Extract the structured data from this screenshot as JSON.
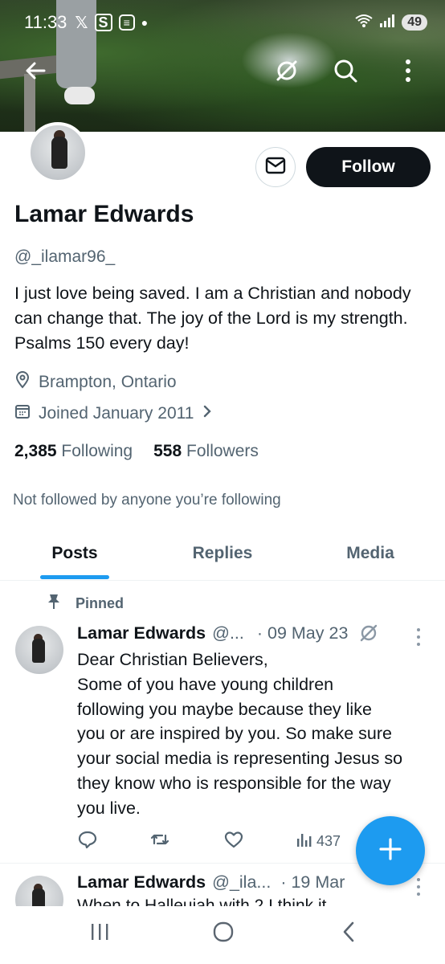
{
  "status_bar": {
    "time": "11:33",
    "icons": [
      "x-icon",
      "s-icon",
      "news-icon",
      "dot-icon"
    ],
    "battery": "49"
  },
  "header": {
    "back_icon": "arrow-left-icon",
    "grok_icon": "grok-icon",
    "search_icon": "search-icon",
    "more_icon": "more-vertical-icon"
  },
  "profile": {
    "name": "Lamar Edwards",
    "handle": "@_ilamar96_",
    "bio": "I just love being saved. I am a Christian and nobody can change that. The joy of the Lord is my strength. Psalms 150 every day!",
    "location": "Brampton, Ontario",
    "joined": "Joined January 2011",
    "following_count": "2,385",
    "following_label": "Following",
    "followers_count": "558",
    "followers_label": "Followers",
    "not_followed": "Not followed by anyone you’re following",
    "follow_label": "Follow"
  },
  "tabs": [
    {
      "label": "Posts",
      "active": true
    },
    {
      "label": "Replies",
      "active": false
    },
    {
      "label": "Media",
      "active": false
    }
  ],
  "posts": [
    {
      "pinned_label": "Pinned",
      "name": "Lamar Edwards",
      "handle": "@...",
      "date": "· 09 May 23",
      "text_lines": [
        "Dear Christian Believers,",
        "Some of you have young children",
        "following you maybe because they like",
        "you or are inspired by you. So make sure",
        "your social media is representing Jesus so",
        "they know who is responsible for the way",
        "you live."
      ],
      "views": "437"
    },
    {
      "name": "Lamar Edwards",
      "handle": "@_ila...",
      "date": "· 19 Mar",
      "peek_text": "When to Halleujah with 2 I think it"
    }
  ],
  "colors": {
    "accent": "#1d9bf0",
    "text": "#0f1419",
    "secondary": "#536471"
  }
}
